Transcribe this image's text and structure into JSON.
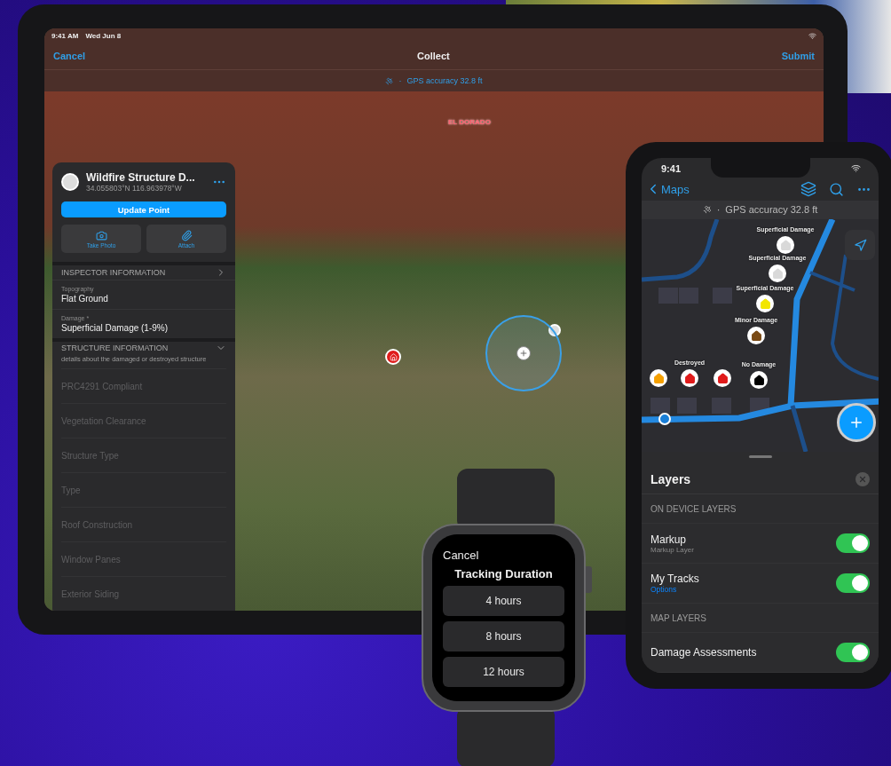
{
  "tablet": {
    "status_time": "9:41 AM",
    "status_date": "Wed Jun 8",
    "nav": {
      "cancel": "Cancel",
      "title": "Collect",
      "submit": "Submit"
    },
    "gps_separator": "·",
    "gps": "GPS accuracy 32.8 ft",
    "map_label": "EL DORADO",
    "panel": {
      "title": "Wildfire Structure D...",
      "coords": "34.055803°N  116.963978°W",
      "primary_button": "Update Point",
      "actions": [
        {
          "kind": "camera",
          "label": "Take Photo"
        },
        {
          "kind": "attach",
          "label": "Attach"
        }
      ],
      "sections": [
        {
          "title": "INSPECTOR INFORMATION",
          "expanded": false,
          "fields": [
            {
              "label": "Topography",
              "value": "Flat Ground"
            },
            {
              "label": "Damage *",
              "value": "Superficial Damage (1-9%)"
            }
          ]
        },
        {
          "title": "STRUCTURE INFORMATION",
          "expanded": true,
          "description": "details about the damaged or destroyed structure",
          "placeholders": [
            "PRC4291 Compliant",
            "Vegetation Clearance",
            "Structure Type",
            "Type",
            "Roof Construction",
            "Window Panes",
            "Exterior Siding"
          ]
        }
      ]
    }
  },
  "phone": {
    "status_time": "9:41",
    "back": "Maps",
    "gps_separator": "·",
    "gps": "GPS accuracy 32.8 ft",
    "markers": [
      {
        "label": "Superficial Damage",
        "color": "#d9d9d9"
      },
      {
        "label": "Superficial Damage",
        "color": "#d9d9d9"
      },
      {
        "label": "Superficial Damage",
        "color": "#f2e600"
      },
      {
        "label": "Minor Damage",
        "color": "#7a4a14"
      },
      {
        "color": "#f5a000"
      },
      {
        "label": "Destroyed",
        "color": "#e01b1b"
      },
      {
        "color": "#e01b1b"
      },
      {
        "label": "No Damage",
        "color": "#000000"
      }
    ],
    "layers": {
      "title": "Layers",
      "groups": [
        {
          "title": "ON DEVICE LAYERS",
          "items": [
            {
              "name": "Markup",
              "subtitle": "Markup Layer",
              "on": true
            },
            {
              "name": "My Tracks",
              "link": "Options",
              "on": true
            }
          ]
        },
        {
          "title": "MAP LAYERS",
          "items": [
            {
              "name": "Damage Assessments",
              "on": true
            }
          ]
        }
      ]
    }
  },
  "watch": {
    "cancel": "Cancel",
    "title": "Tracking Duration",
    "options": [
      "4 hours",
      "8 hours",
      "12 hours"
    ]
  }
}
